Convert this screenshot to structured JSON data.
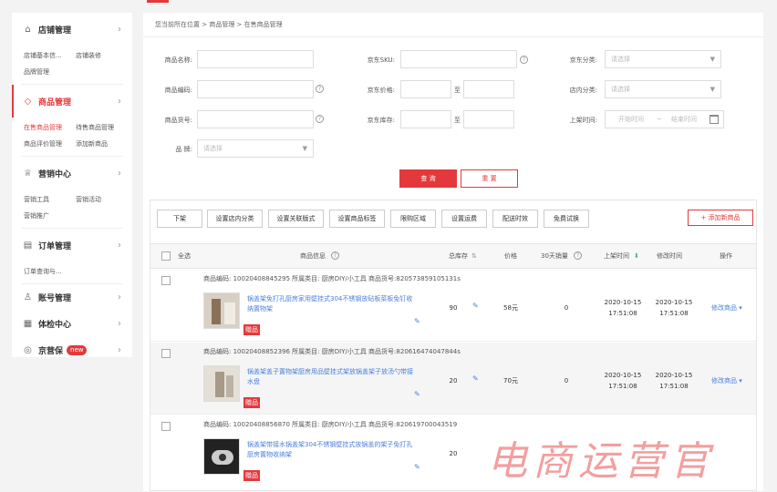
{
  "sidebar": {
    "sections": [
      {
        "title": "店铺管理",
        "icon": "store-icon",
        "items": [
          "店铺基本信...",
          "店铺装修",
          "品牌管理"
        ]
      },
      {
        "title": "商品管理",
        "icon": "bag-icon",
        "active": true,
        "items": [
          "在售商品管理",
          "待售商品管理",
          "商品评价管理",
          "添加新商品"
        ]
      },
      {
        "title": "营销中心",
        "icon": "crown-icon",
        "items": [
          "营销工具",
          "营销活动",
          "营销推广"
        ]
      },
      {
        "title": "订单管理",
        "icon": "document-icon",
        "items": [
          "订单查询与..."
        ]
      },
      {
        "title": "账号管理",
        "icon": "user-icon",
        "items": []
      },
      {
        "title": "体检中心",
        "icon": "grid-icon",
        "items": []
      },
      {
        "title": "京营保",
        "icon": "target-icon",
        "badge": "new",
        "items": []
      }
    ]
  },
  "breadcrumb": "您当前所在位置 > 商品管理 > 在售商品管理",
  "filters": {
    "product_name": "商品名称:",
    "jd_sku": "京东SKU:",
    "jd_category": "京东分类:",
    "product_code": "商品编码:",
    "jd_price": "京东价格:",
    "shop_category": "店内分类:",
    "product_sku_no": "商品货号:",
    "jd_stock": "京东库存:",
    "listing_time": "上架时间:",
    "brand": "品 牌:",
    "select_placeholder": "请选择",
    "to": "至",
    "start_time": "开始时间",
    "end_time": "结束时间",
    "date_sep": "~"
  },
  "buttons": {
    "query": "查 询",
    "reset": "重 置"
  },
  "actions": [
    "下架",
    "设置店内分类",
    "设置关联版式",
    "设置商品标签",
    "限购区域",
    "设置运费",
    "配送时效",
    "免费试换"
  ],
  "add_product": "+ 添加新商品",
  "table": {
    "headers": {
      "select_all": "全选",
      "info": "商品信息",
      "stock": "总库存",
      "price": "价格",
      "sales30": "30天销量",
      "listing_time": "上架时间",
      "modify_time": "修改时间",
      "ops": "操作"
    },
    "rows": [
      {
        "meta": "商品编码: 10020408845295 所属类目: 厨房DIY/小工具 商品货号:820573859105131s",
        "name": "锅盖架免打孔厨房家用壁挂式304不锈钢放砧板菜板免钉收纳置物架",
        "gift": "赠品",
        "stock": "90",
        "price": "58元",
        "sales": "0",
        "listing_date": "2020-10-15",
        "listing_clock": "17:51:08",
        "modify_date": "2020-10-15",
        "modify_clock": "17:51:08",
        "op": "修改商品"
      },
      {
        "meta": "商品编码: 10020408852396 所属类目: 厨房DIY/小工具 商品货号:820616474047844s",
        "name": "锅盖架盖子置物架厨房用品壁挂式架放锅盖架子放汤勺带接水盘",
        "gift": "赠品",
        "stock": "20",
        "price": "70元",
        "sales": "0",
        "listing_date": "2020-10-15",
        "listing_clock": "17:51:08",
        "modify_date": "2020-10-15",
        "modify_clock": "17:51:08",
        "op": "修改商品"
      },
      {
        "meta": "商品编码: 10020408856870 所属类目: 厨房DIY/小工具 商品货号:820619700043519",
        "name": "锅盖架带接水锅盖架304不锈钢壁挂式放锅盖的架子免打孔厨房置物收纳架",
        "gift": "赠品",
        "stock": "20"
      }
    ]
  },
  "watermark": "电商运营官"
}
